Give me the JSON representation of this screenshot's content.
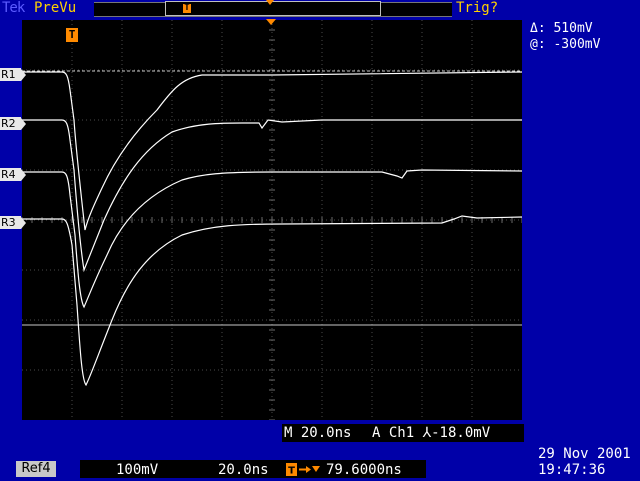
{
  "header": {
    "brand": "Tek",
    "mode": "PreVu",
    "trigger_status": "Trig?"
  },
  "readouts": {
    "delta": "Δ:   510mV",
    "at": "@:  -300mV"
  },
  "graticule": {
    "trigger_marker": "T",
    "refs": [
      {
        "label": "R1"
      },
      {
        "label": "R2"
      },
      {
        "label": "R4"
      },
      {
        "label": "R3"
      }
    ]
  },
  "bottom": {
    "timebase": "M 20.0ns",
    "trigger": "A  Ch1 ⅄-18.0mV"
  },
  "status": {
    "ref_button": "Ref4",
    "volts_div": "100mV",
    "time_div": "20.0ns",
    "delay": "79.6000ns",
    "date": "29 Nov 2001",
    "clock": "19:47:36"
  },
  "colors": {
    "background": "#0000a8",
    "trace": "#ffffff",
    "trigger": "#ff8a00",
    "accent": "#ffd200"
  }
}
